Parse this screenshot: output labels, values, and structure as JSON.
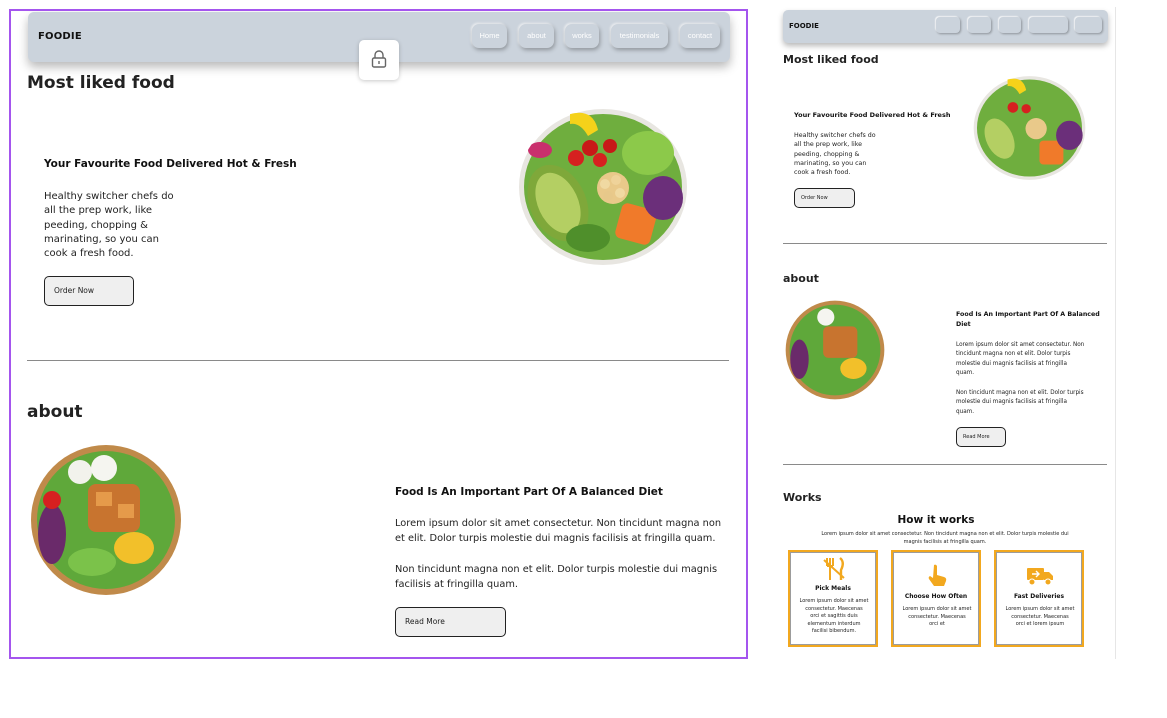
{
  "brand": "FOODIE",
  "nav": {
    "items": [
      "Home",
      "about",
      "works",
      "testimonials",
      "contact"
    ]
  },
  "hero": {
    "section_title": "Most liked food",
    "card_title": "Your Favourite Food Delivered Hot & Fresh",
    "description": [
      "Healthy switcher chefs do",
      "all the prep work, like",
      "peeding, chopping &",
      "marinating, so you can",
      "cook a fresh food."
    ],
    "button_label": "Order Now"
  },
  "about": {
    "section_title": "about",
    "card_title": "Food Is An Important Part Of A Balanced Diet",
    "paragraph1": [
      "Lorem ipsum dolor sit amet consectetur. Non tincidunt magna non",
      "et elit. Dolor turpis molestie dui magnis facilisis at fringilla quam."
    ],
    "paragraph2": [
      "Non tincidunt magna non et elit. Dolor turpis molestie dui magnis",
      "facilisis at fringilla quam."
    ],
    "button_label": "Read More"
  },
  "preview": {
    "hero": {
      "description": [
        "Healthy switcher chefs do",
        "all the prep work, like",
        "peeding, chopping &",
        "marinating, so you can",
        "cook a fresh food."
      ]
    },
    "about": {
      "card_title": [
        "Food Is An Important Part Of A Balanced",
        "Diet"
      ],
      "paragraph1": [
        "Lorem ipsum dolor sit amet consectetur. Non",
        "tincidunt magna non et elit. Dolor turpis",
        "molestie dui magnis facilisis at fringilla",
        "quam."
      ],
      "paragraph2": [
        "Non tincidunt magna non et elit. Dolor turpis",
        "molestie dui magnis facilisis at fringilla",
        "quam."
      ]
    },
    "works": {
      "section_title": "Works",
      "heading": "How it works",
      "subtitle": [
        "Lorem ipsum dolor sit amet consectetur. Non tincidunt magna non et elit. Dolor turpis molestie dui",
        "magnis facilisis at fringilla quam."
      ],
      "cards": [
        {
          "icon": "utensils-icon",
          "title": "Pick Meals",
          "text": [
            "Lorem ipsum dolor sit amet",
            "consectetur. Maecenas",
            "orci et sagittis duis",
            "elementum interdum",
            "facilisi bibendum."
          ]
        },
        {
          "icon": "hand-pointer-icon",
          "title": "Choose How Often",
          "text": [
            "Lorem ipsum dolor sit amet",
            "consectetur. Maecenas",
            "orci et"
          ]
        },
        {
          "icon": "delivery-truck-icon",
          "title": "Fast Deliveries",
          "text": [
            "Lorem ipsum dolor sit amet",
            "consectetur. Maecenas",
            "orci et lorem ipsum"
          ]
        }
      ]
    }
  },
  "colors": {
    "frame_border": "#a455ee",
    "nav_background": "#cbd3dc",
    "accent_orange": "#f2a81f",
    "heading": "#222222"
  }
}
